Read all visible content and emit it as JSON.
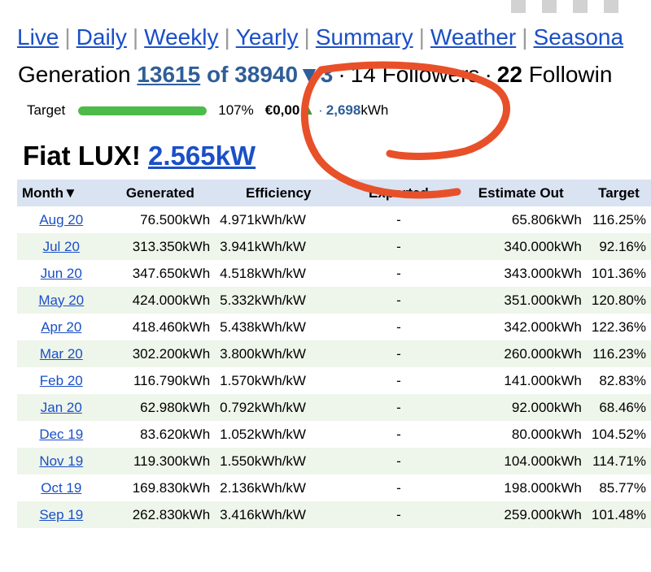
{
  "nav": {
    "links": [
      "Live",
      "Daily",
      "Weekly",
      "Yearly",
      "Summary",
      "Weather",
      "Seasona"
    ],
    "separator": "|"
  },
  "generation": {
    "prefix": "Generation",
    "rank": "13615",
    "of_total": "of 38940",
    "arrow": "▼3",
    "followers_count": "14",
    "followers_label": "Followers",
    "following_count": "22",
    "following_label": "Followin"
  },
  "target": {
    "label": "Target",
    "progress_percent": 100,
    "percent_text": "107%",
    "money": "€0,00",
    "up_arrow": "▲",
    "energy_value": "2,698",
    "energy_unit": "kWh"
  },
  "system": {
    "name": "Fiat LUX!",
    "size": "2.565kW"
  },
  "table": {
    "headers": [
      "Month▼",
      "Generated",
      "Efficiency",
      "Exported",
      "Estimate Out",
      "Target"
    ],
    "rows": [
      {
        "month": "Aug 20",
        "generated": "76.500kWh",
        "efficiency": "4.971kWh/kW",
        "exported": "-",
        "estimate": "65.806kWh",
        "target": "116.25%"
      },
      {
        "month": "Jul 20",
        "generated": "313.350kWh",
        "efficiency": "3.941kWh/kW",
        "exported": "-",
        "estimate": "340.000kWh",
        "target": "92.16%"
      },
      {
        "month": "Jun 20",
        "generated": "347.650kWh",
        "efficiency": "4.518kWh/kW",
        "exported": "-",
        "estimate": "343.000kWh",
        "target": "101.36%"
      },
      {
        "month": "May 20",
        "generated": "424.000kWh",
        "efficiency": "5.332kWh/kW",
        "exported": "-",
        "estimate": "351.000kWh",
        "target": "120.80%"
      },
      {
        "month": "Apr 20",
        "generated": "418.460kWh",
        "efficiency": "5.438kWh/kW",
        "exported": "-",
        "estimate": "342.000kWh",
        "target": "122.36%"
      },
      {
        "month": "Mar 20",
        "generated": "302.200kWh",
        "efficiency": "3.800kWh/kW",
        "exported": "-",
        "estimate": "260.000kWh",
        "target": "116.23%"
      },
      {
        "month": "Feb 20",
        "generated": "116.790kWh",
        "efficiency": "1.570kWh/kW",
        "exported": "-",
        "estimate": "141.000kWh",
        "target": "82.83%"
      },
      {
        "month": "Jan 20",
        "generated": "62.980kWh",
        "efficiency": "0.792kWh/kW",
        "exported": "-",
        "estimate": "92.000kWh",
        "target": "68.46%"
      },
      {
        "month": "Dec 19",
        "generated": "83.620kWh",
        "efficiency": "1.052kWh/kW",
        "exported": "-",
        "estimate": "80.000kWh",
        "target": "104.52%"
      },
      {
        "month": "Nov 19",
        "generated": "119.300kWh",
        "efficiency": "1.550kWh/kW",
        "exported": "-",
        "estimate": "104.000kWh",
        "target": "114.71%"
      },
      {
        "month": "Oct 19",
        "generated": "169.830kWh",
        "efficiency": "2.136kWh/kW",
        "exported": "-",
        "estimate": "198.000kWh",
        "target": "85.77%"
      },
      {
        "month": "Sep 19",
        "generated": "262.830kWh",
        "efficiency": "3.416kWh/kW",
        "exported": "-",
        "estimate": "259.000kWh",
        "target": "101.48%"
      }
    ]
  },
  "colors": {
    "link": "#1a4fc7",
    "accent_blue": "#2f5e98",
    "progress_green": "#4cbb4a",
    "row_alt": "#eef5ea",
    "header_bg": "#d9e3f2",
    "annotation": "#e8502a"
  },
  "annotation": {
    "type": "hand-drawn-circle"
  }
}
